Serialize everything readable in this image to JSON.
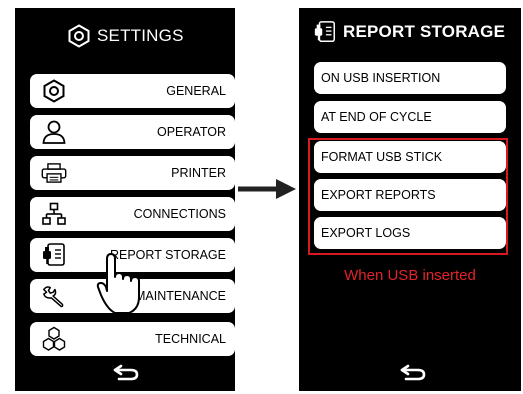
{
  "settings_screen": {
    "title": "SETTINGS",
    "title_icon": "hexagon-settings-icon",
    "items": [
      {
        "label": "GENERAL",
        "icon": "hexagon-nut-icon"
      },
      {
        "label": "OPERATOR",
        "icon": "user-icon"
      },
      {
        "label": "PRINTER",
        "icon": "printer-icon"
      },
      {
        "label": "CONNECTIONS",
        "icon": "network-icon"
      },
      {
        "label": "REPORT STORAGE",
        "icon": "usb-document-icon"
      },
      {
        "label": "MAINTENANCE",
        "icon": "wrench-icon"
      },
      {
        "label": "TECHNICAL",
        "icon": "hexagons-icon"
      }
    ],
    "back_icon": "back-arrow-icon"
  },
  "report_storage_screen": {
    "title": "REPORT STORAGE",
    "title_icon": "usb-document-icon",
    "options": [
      {
        "label": "ON USB INSERTION"
      },
      {
        "label": "AT END OF CYCLE"
      },
      {
        "label": "FORMAT USB STICK"
      },
      {
        "label": "EXPORT REPORTS"
      },
      {
        "label": "EXPORT LOGS"
      }
    ],
    "usb_note": "When USB inserted",
    "back_icon": "back-arrow-icon"
  },
  "colors": {
    "screen_bg": "#000000",
    "button_bg": "#ffffff",
    "highlight": "#d71920"
  }
}
